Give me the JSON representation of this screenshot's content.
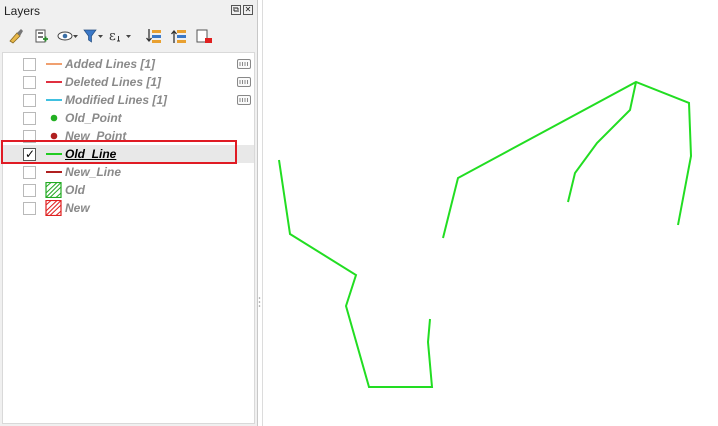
{
  "panel": {
    "title": "Layers",
    "float_glyph": "⧉",
    "close_glyph": "✕"
  },
  "toolbar": {
    "icons": [
      "style-manager-icon",
      "add-group-icon",
      "visibility-icon",
      "filter-legend-icon",
      "filter-expression-icon",
      "expand-all-icon",
      "collapse-all-icon",
      "remove-layer-icon"
    ]
  },
  "layers": [
    {
      "label": "Added Lines [1]",
      "checked": false,
      "symbol": "line",
      "color": "#f0a070",
      "has_filter": true
    },
    {
      "label": "Deleted Lines [1]",
      "checked": false,
      "symbol": "line",
      "color": "#e03040",
      "has_filter": true
    },
    {
      "label": "Modified Lines [1]",
      "checked": false,
      "symbol": "line",
      "color": "#40c0e0",
      "has_filter": true
    },
    {
      "label": "Old_Point",
      "checked": false,
      "symbol": "point",
      "color": "#22b022",
      "has_filter": false
    },
    {
      "label": "New_Point",
      "checked": false,
      "symbol": "point",
      "color": "#b02020",
      "has_filter": false
    },
    {
      "label": "Old_Line",
      "checked": true,
      "symbol": "line",
      "color": "#22cc22",
      "has_filter": false,
      "active": true
    },
    {
      "label": "New_Line",
      "checked": false,
      "symbol": "line",
      "color": "#b02020",
      "has_filter": false
    },
    {
      "label": "Old",
      "checked": false,
      "symbol": "polygon",
      "color": "#22aa22",
      "has_filter": false
    },
    {
      "label": "New",
      "checked": false,
      "symbol": "polygon",
      "color": "#e02020",
      "has_filter": false
    }
  ],
  "map": {
    "line_color": "#22dd22"
  }
}
